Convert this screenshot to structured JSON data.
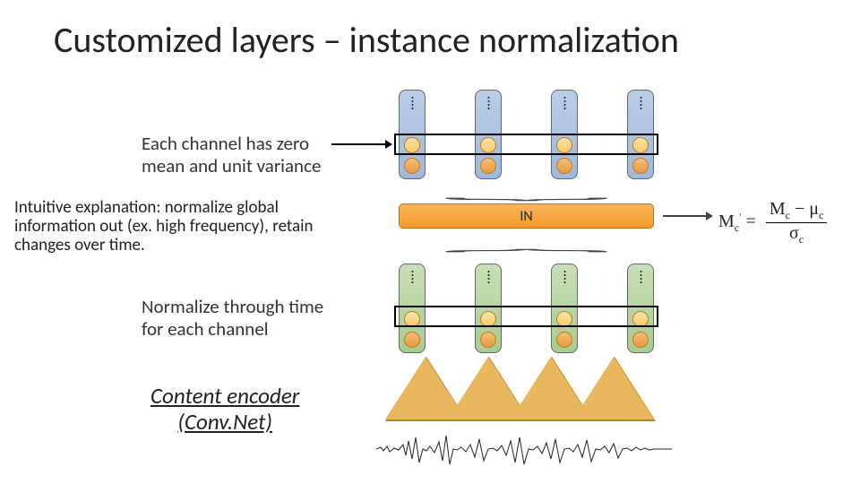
{
  "title": "Customized layers – instance normalization",
  "text_zero_mean": "Each channel has zero\nmean and unit variance",
  "intuitive": "Intuitive explanation: normalize global information out (ex. high frequency),  retain changes over time.",
  "normalize_time": "Normalize through time\nfor each channel",
  "content_encoder": "Content encoder\n(Conv.Net)",
  "in_label": "IN",
  "formula": {
    "lhs": "M",
    "lhs_sub": "c",
    "lhs_prime": "′",
    "num_M": "M",
    "num_sub": "c",
    "num_mu": "μ",
    "num_mu_sub": "c",
    "den_sigma": "σ",
    "den_sub": "c"
  },
  "vector_columns": 4,
  "pyramid_count": 4,
  "colors": {
    "blue_vec": "#9fb9db",
    "green_vec": "#a9cc90",
    "orange_box": "#f59a2c",
    "pyramid": "#e9b75d"
  }
}
